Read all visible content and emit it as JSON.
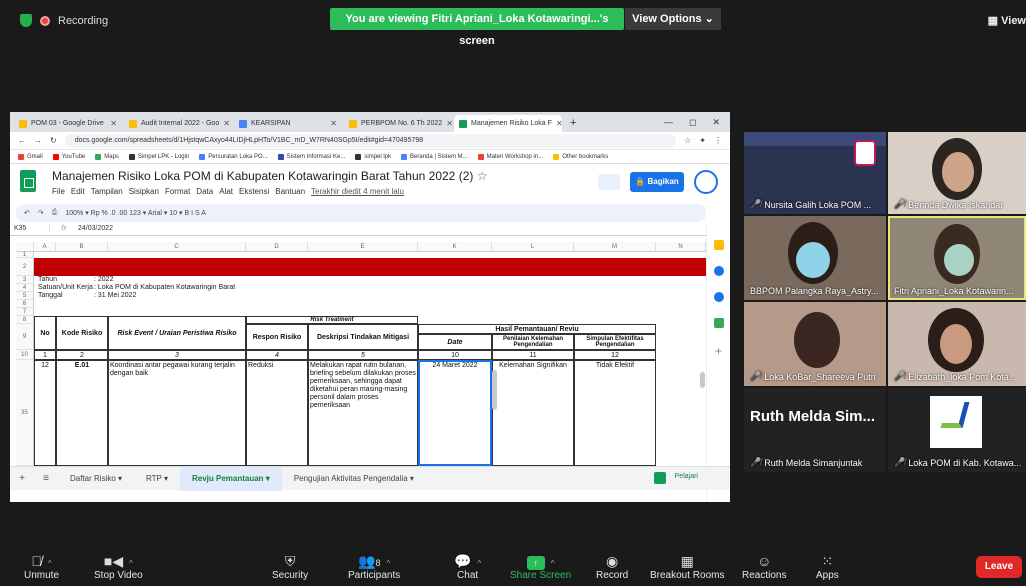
{
  "zoom": {
    "recording_label": "Recording",
    "viewing_banner": "You are viewing Fitri Apriani_Loka Kotawaringi...'s screen",
    "view_options": "View Options ⌄",
    "view_right": "View"
  },
  "browser": {
    "tabs": [
      {
        "label": "POM 03 - Google Drive"
      },
      {
        "label": "Audit Internal 2022 - Goo"
      },
      {
        "label": "KEARSIPAN"
      },
      {
        "label": "PERBPOM No. 6 Th 2022"
      },
      {
        "label": "Manajemen Risiko Loka F"
      }
    ],
    "url": "docs.google.com/spreadsheets/d/1HjstqwCAxyo44LIDjHLpHTo/V1BC_mD_W7RN40SGp5I/edit#gid=470495798",
    "bookmarks": [
      "Gmail",
      "YouTube",
      "Maps",
      "Simpel LPK - Login",
      "Persuratan Loka PO...",
      "Sistem Informasi Ke...",
      "simpel lpk",
      "Beranda | Sistem M...",
      "Materi Workshop in...",
      "Other bookmarks"
    ]
  },
  "sheet": {
    "title": "Manajemen Risiko Loka POM di Kabupaten Kotawaringin Barat Tahun 2022 (2)",
    "menu": [
      "File",
      "Edit",
      "Tampilan",
      "Sisipkan",
      "Format",
      "Data",
      "Alat",
      "Ekstensi",
      "Bantuan"
    ],
    "last_edit": "Terakhir diedit 4 menit lalu",
    "share_label": "Bagikan",
    "toolbar": "100% ▾   Rp   %   .0   .00   123 ▾   Arial   ▾   10   ▾   B   I   S   A",
    "cell_ref": "K35",
    "fx": "fx",
    "formula_value": "24/03/2022",
    "col_headers": [
      "A",
      "B",
      "C",
      "D",
      "E",
      "K",
      "L",
      "M",
      "N"
    ],
    "row_numbers": [
      "1",
      "2",
      "3",
      "4",
      "5",
      "6",
      "7",
      "8",
      "9",
      "10",
      "35"
    ],
    "info": [
      {
        "label": "Tahun",
        "value": ": 2022"
      },
      {
        "label": "Satuan/Unit Kerja",
        "value": ": Loka POM di Kabupaten Kotawaringin Barat"
      },
      {
        "label": "Tanggal",
        "value": ": 31 Mei 2022"
      }
    ],
    "headers": {
      "no": "No",
      "kode": "Kode Risiko",
      "event": "Risk Event / Uraian Peristiwa Risiko",
      "treatment": "Risk Treatment",
      "respon": "Respon Risiko",
      "deskripsi": "Deskripsi Tindakan Mitigasi",
      "hasil": "Hasil Pemantauan/ Reviu",
      "date": "Date",
      "penilaian": "Penilaian Kelemahan Pengendalian",
      "simpulan": "Simpulan Efektifitas Pengendalian"
    },
    "numbering": [
      "1",
      "2",
      "3",
      "4",
      "5",
      "10",
      "11",
      "12"
    ],
    "row": {
      "no": "12",
      "kode": "E.01",
      "event": "Koordinasi antar pegawai kurang terjalin dengan baik",
      "respon": "Reduksi",
      "deskripsi": "Melakukan rapat rutin bulanan, briefing sebelum dilakukan proses pemeriksaan, sehingga dapat diketahui peran masing-masing personil dalam proses pemeriksaan",
      "date": "24 Maret 2022",
      "penilaian": "Kelemahan Signifikan",
      "simpulan": "Tidak Efektif"
    },
    "sheet_tabs": [
      "Daftar Risiko ▾",
      "RTP ▾",
      "Revju Pemantauan ▾",
      "Pengujian Aktivitas Pengendalia ▾"
    ],
    "pelajari": "Pelajari"
  },
  "participants": [
    {
      "name": "Nursita Galih Loka POM ...",
      "muted": true
    },
    {
      "name": "Berinda Dwika Iskandar",
      "muted": true
    },
    {
      "name": "BBPOM Palangka Raya_Astry...",
      "muted": false
    },
    {
      "name": "Fitri Apriani_Loka Kotawarin...",
      "muted": false
    },
    {
      "name": "Loka KoBar_Shareeva Putri",
      "muted": true
    },
    {
      "name": "Elizabath_loka Pom Kota...",
      "muted": true
    },
    {
      "name": "Ruth Melda Simanjuntak",
      "muted": true,
      "big": "Ruth Melda Sim..."
    },
    {
      "name": "Loka POM di Kab. Kotawa...",
      "muted": true
    }
  ],
  "controls": {
    "unmute": "Unmute",
    "stop_video": "Stop Video",
    "security": "Security",
    "participants": "Participants",
    "participants_count": "8",
    "chat": "Chat",
    "share_screen": "Share Screen",
    "record": "Record",
    "breakout": "Breakout Rooms",
    "reactions": "Reactions",
    "apps": "Apps",
    "leave": "Leave"
  },
  "colors": {
    "zoom_green": "#2cbd5a",
    "leave_red": "#e02828",
    "sheet_red_band": "#c00000",
    "sheets_green": "#0f9d58"
  }
}
